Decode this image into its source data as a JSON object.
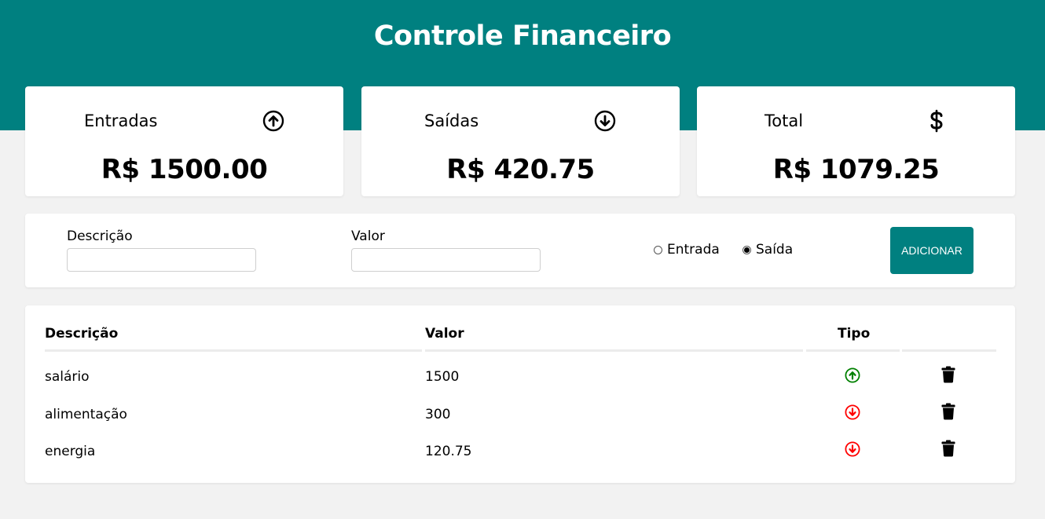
{
  "header": {
    "title": "Controle Financeiro",
    "background": "#008080"
  },
  "summary": {
    "income": {
      "label": "Entradas",
      "icon": "arrow-up-circle-icon",
      "value": "R$ 1500.00"
    },
    "expense": {
      "label": "Saídas",
      "icon": "arrow-down-circle-icon",
      "value": "R$ 420.75"
    },
    "total": {
      "label": "Total",
      "icon": "dollar-icon",
      "value": "R$ 1079.25"
    }
  },
  "form": {
    "description_label": "Descrição",
    "description_value": "",
    "value_label": "Valor",
    "value_value": "",
    "radio_income_label": "Entrada",
    "radio_expense_label": "Saída",
    "selected_type": "Saída",
    "add_button_label": "ADICIONAR"
  },
  "table": {
    "headers": {
      "description": "Descrição",
      "value": "Valor",
      "type": "Tipo"
    },
    "rows": [
      {
        "description": "salário",
        "value": "1500",
        "type": "entrada",
        "type_icon": "arrow-up-circle-icon",
        "type_color": "#008000"
      },
      {
        "description": "alimentação",
        "value": "300",
        "type": "saida",
        "type_icon": "arrow-down-circle-icon",
        "type_color": "#ff0000"
      },
      {
        "description": "energia",
        "value": "120.75",
        "type": "saida",
        "type_icon": "arrow-down-circle-icon",
        "type_color": "#ff0000"
      }
    ],
    "delete_icon": "trash-icon"
  },
  "colors": {
    "accent": "#008080",
    "income": "#008000",
    "expense": "#ff0000"
  }
}
